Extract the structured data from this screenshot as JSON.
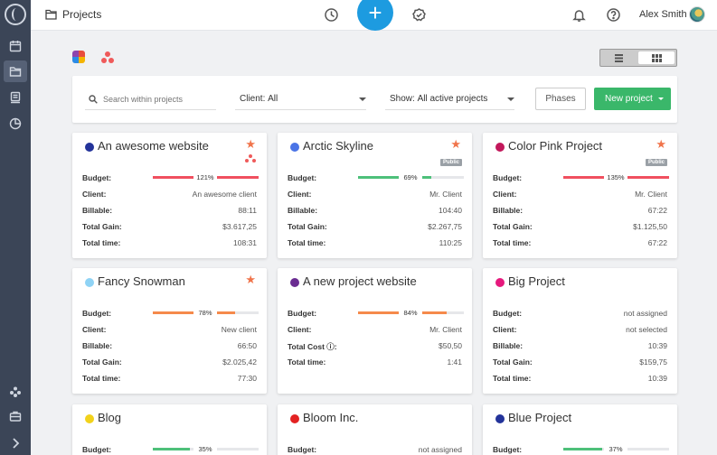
{
  "topbar": {
    "title": "Projects",
    "add_label": "+",
    "user_name": "Alex Smith"
  },
  "filters": {
    "search_placeholder": "Search within projects",
    "client_label": "Client:",
    "client_value": "All",
    "show_label": "Show:",
    "show_value": "All active projects",
    "phases_label": "Phases",
    "new_project_label": "New project"
  },
  "labels": {
    "budget": "Budget:",
    "client": "Client:",
    "billable": "Billable:",
    "total_gain": "Total Gain:",
    "total_time": "Total time:",
    "total_cost": "Total Cost ⓘ:"
  },
  "colors": {
    "accent": "#1d9be0",
    "primary_button": "#3ab76a",
    "star": "#f0744b",
    "over_budget": "#f0505f",
    "on_track": "#4ec07a",
    "warning": "#f58a4b"
  },
  "projects": [
    {
      "name": "An awesome website",
      "dot_color": "#23339a",
      "starred": true,
      "badge": "",
      "asana": true,
      "budget_pct": 121,
      "budget_text": "121%",
      "bar_color": "#f0505f",
      "client": "An awesome client",
      "billable": "88:11",
      "total_gain": "$3.617,25",
      "total_time": "108:31"
    },
    {
      "name": "Arctic Skyline",
      "dot_color": "#4a74e6",
      "starred": true,
      "badge": "Public",
      "asana": false,
      "budget_pct": 69,
      "budget_text": "69%",
      "bar_color": "#4ec07a",
      "client": "Mr. Client",
      "billable": "104:40",
      "total_gain": "$2.267,75",
      "total_time": "110:25"
    },
    {
      "name": "Color Pink Project",
      "dot_color": "#c2185b",
      "starred": true,
      "badge": "Public",
      "asana": false,
      "budget_pct": 135,
      "budget_text": "135%",
      "bar_color": "#f0505f",
      "client": "Mr. Client",
      "billable": "67:22",
      "total_gain": "$1.125,50",
      "total_time": "67:22"
    },
    {
      "name": "Fancy Snowman",
      "dot_color": "#8fd3f5",
      "starred": true,
      "badge": "",
      "asana": false,
      "budget_pct": 78,
      "budget_text": "78%",
      "bar_color": "#f58a4b",
      "client": "New client",
      "billable": "66:50",
      "total_gain": "$2.025,42",
      "total_time": "77:30"
    },
    {
      "name": "A new project website",
      "dot_color": "#6a2c91",
      "starred": false,
      "badge": "",
      "asana": false,
      "budget_pct": 84,
      "budget_text": "84%",
      "bar_color": "#f58a4b",
      "client": "Mr. Client",
      "total_cost": "$50,50",
      "total_time": "1:41"
    },
    {
      "name": "Big Project",
      "dot_color": "#e6197d",
      "starred": false,
      "badge": "",
      "asana": false,
      "budget_text": "not assigned",
      "client": "not selected",
      "billable": "10:39",
      "total_gain": "$159,75",
      "total_time": "10:39"
    },
    {
      "name": "Blog",
      "dot_color": "#f2d21b",
      "starred": false,
      "badge": "",
      "asana": false,
      "budget_pct": 35,
      "budget_text": "35%",
      "bar_color": "#4ec07a"
    },
    {
      "name": "Bloom Inc.",
      "dot_color": "#e32222",
      "starred": false,
      "badge": "",
      "asana": false,
      "budget_text": "not assigned"
    },
    {
      "name": "Blue Project",
      "dot_color": "#23339a",
      "starred": false,
      "badge": "",
      "asana": false,
      "budget_pct": 37,
      "budget_text": "37%",
      "bar_color": "#4ec07a"
    }
  ]
}
